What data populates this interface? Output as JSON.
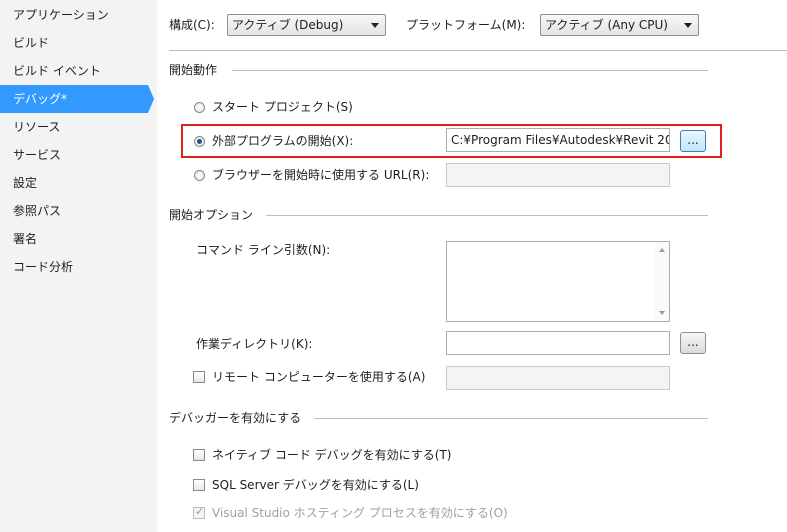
{
  "sidebar": {
    "items": [
      {
        "label": "アプリケーション"
      },
      {
        "label": "ビルド"
      },
      {
        "label": "ビルド イベント"
      },
      {
        "label": "デバッグ*",
        "active": true
      },
      {
        "label": "リソース"
      },
      {
        "label": "サービス"
      },
      {
        "label": "設定"
      },
      {
        "label": "参照パス"
      },
      {
        "label": "署名"
      },
      {
        "label": "コード分析"
      }
    ]
  },
  "config": {
    "config_label": "構成(C):",
    "config_value": "アクティブ (Debug)",
    "platform_label": "プラットフォーム(M):",
    "platform_value": "アクティブ (Any CPU)"
  },
  "start_action": {
    "header": "開始動作",
    "start_project": "スタート プロジェクト(S)",
    "external_program": "外部プログラムの開始(X):",
    "external_program_path": "C:¥Program Files¥Autodesk¥Revit 20:",
    "browser_url": "ブラウザーを開始時に使用する URL(R):",
    "browse_label": "..."
  },
  "start_options": {
    "header": "開始オプション",
    "cmd_args": "コマンド ライン引数(N):",
    "working_dir": "作業ディレクトリ(K):",
    "remote_machine": "リモート コンピューターを使用する(A)",
    "browse_label": "..."
  },
  "debuggers": {
    "header": "デバッガーを有効にする",
    "native": "ネイティブ コード デバッグを有効にする(T)",
    "sql": "SQL Server デバッグを有効にする(L)",
    "vs_hosting": "Visual Studio ホスティング プロセスを有効にする(O)"
  }
}
